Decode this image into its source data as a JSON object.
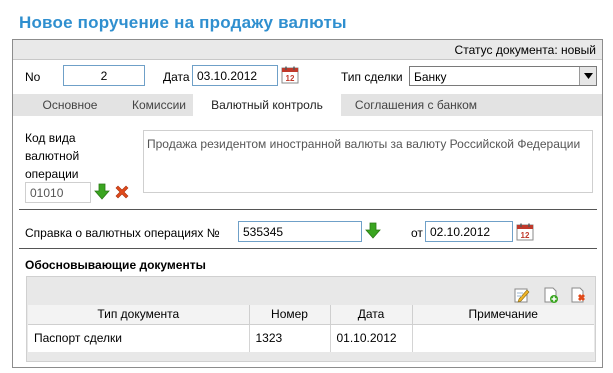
{
  "page_title": "Новое поручение на продажу валюты",
  "status": "Статус документа: новый",
  "number": {
    "label": "No",
    "value": "2"
  },
  "date": {
    "label": "Дата",
    "value": "03.10.2012",
    "calendar_icon": "calendar-icon"
  },
  "deal_type": {
    "label": "Тип сделки",
    "value": "Банку"
  },
  "tabs": [
    {
      "label": "Основное",
      "active": false
    },
    {
      "label": "Комиссии",
      "active": false
    },
    {
      "label": "Валютный контроль",
      "active": true
    },
    {
      "label": "Соглашения с банком",
      "active": false
    }
  ],
  "operation": {
    "label_line1": "Код вида",
    "label_line2": "валютной",
    "label_line3": "операции",
    "code": "01010",
    "description": "Продажа резидентом иностранной валюты за валюту Российской Федерации"
  },
  "certificate": {
    "label": "Справка о валютных операциях №",
    "number": "535345",
    "from_label": "от",
    "date": "02.10.2012"
  },
  "documents": {
    "heading": "Обосновывающие документы",
    "columns": [
      "Тип документа",
      "Номер",
      "Дата",
      "Примечание"
    ],
    "rows": [
      [
        "Паспорт сделки",
        "1323",
        "01.10.2012",
        ""
      ]
    ]
  },
  "colors": {
    "title_blue": "#2f8fcf",
    "input_border": "#6fa0c8",
    "arrow_green": "#3aa520",
    "delete_red": "#e04a1a"
  }
}
